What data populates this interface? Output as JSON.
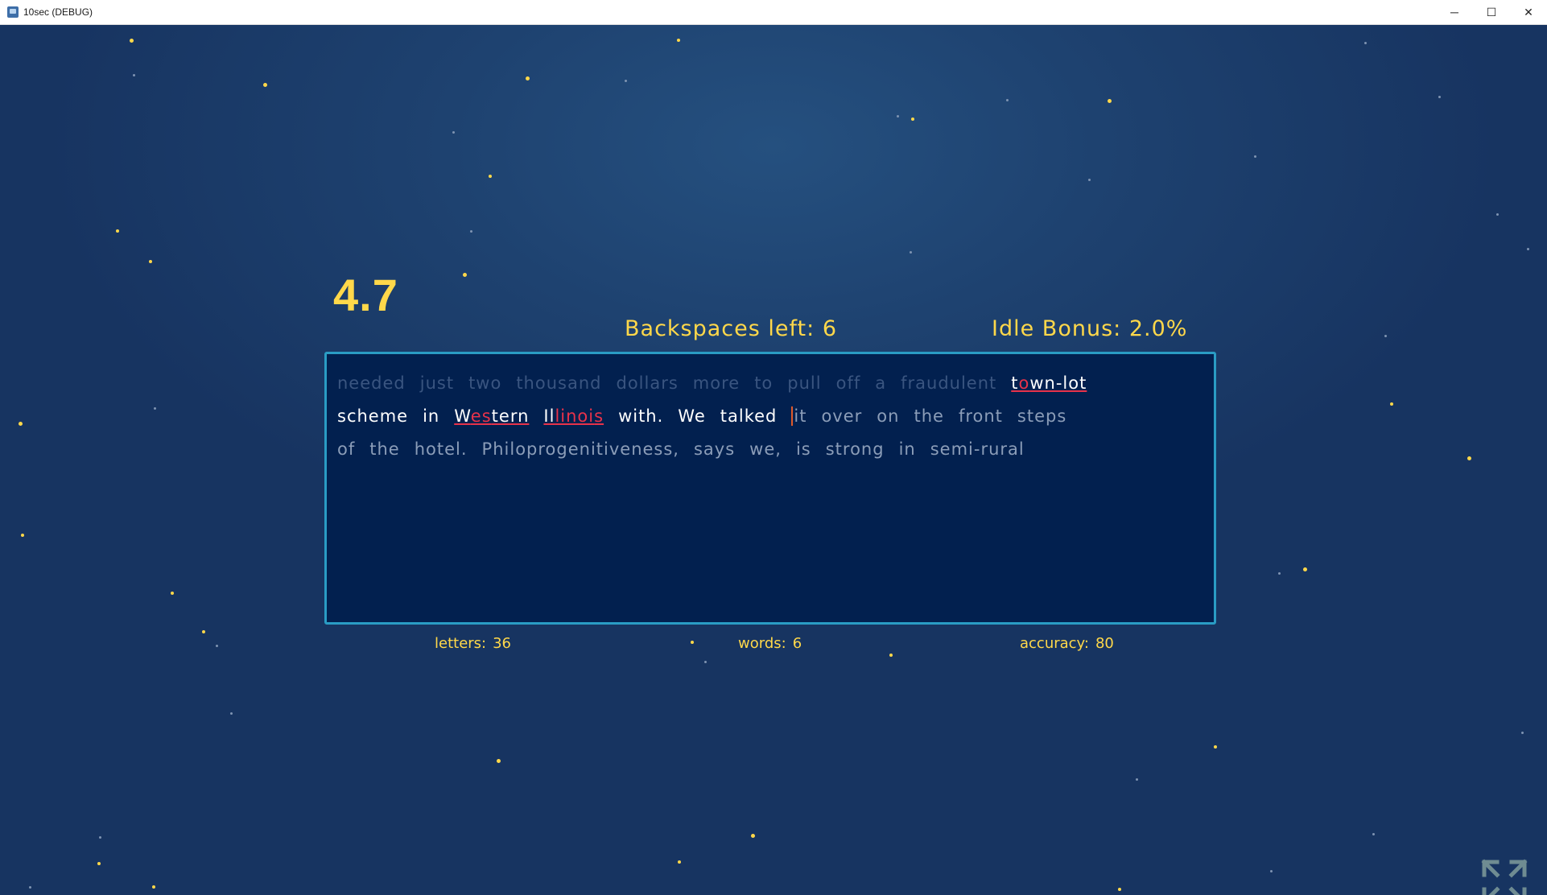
{
  "window": {
    "title": "10sec (DEBUG)",
    "controls": {
      "minimize": "─",
      "maximize": "☐",
      "close": "✕"
    }
  },
  "hud": {
    "timer": "4.7",
    "backspaces_label": "Backspaces left:",
    "backspaces_value": "6",
    "idle_label": "Idle Bonus:",
    "idle_value": "2.0%"
  },
  "text": {
    "line1": [
      {
        "t": "needed",
        "s": "faded"
      },
      {
        "t": "just",
        "s": "faded"
      },
      {
        "t": "two",
        "s": "faded"
      },
      {
        "t": "thousand",
        "s": "faded"
      },
      {
        "t": "dollars",
        "s": "faded"
      },
      {
        "t": "more",
        "s": "faded"
      },
      {
        "t": "to",
        "s": "faded"
      },
      {
        "t": "pull",
        "s": "faded"
      },
      {
        "t": "off",
        "s": "faded"
      },
      {
        "t": "a",
        "s": "faded"
      },
      {
        "t": "fraudulent",
        "s": "faded"
      },
      {
        "parts": [
          [
            "t",
            "typed"
          ],
          [
            "o",
            "err"
          ],
          [
            "wn-lot",
            "typed"
          ]
        ],
        "underline": true
      }
    ],
    "line2": [
      {
        "t": "scheme",
        "s": "typed"
      },
      {
        "t": "in",
        "s": "typed"
      },
      {
        "parts": [
          [
            "W",
            "typed"
          ],
          [
            "es",
            "err"
          ],
          [
            "tern",
            "typed"
          ]
        ],
        "underline": true
      },
      {
        "parts": [
          [
            "Il",
            "typed"
          ],
          [
            "linoi",
            "err"
          ],
          [
            "s",
            "err"
          ]
        ],
        "underline": true
      },
      {
        "t": "with.",
        "s": "typed"
      },
      {
        "t": "We",
        "s": "typed"
      },
      {
        "t": "talked",
        "s": "typed"
      },
      {
        "t": "it",
        "s": "pending",
        "caret": true
      },
      {
        "t": "over",
        "s": "pending"
      },
      {
        "t": "on",
        "s": "pending"
      },
      {
        "t": "the",
        "s": "pending"
      },
      {
        "t": "front",
        "s": "pending"
      },
      {
        "t": "steps",
        "s": "pending"
      }
    ],
    "line3": [
      {
        "t": "of",
        "s": "pending"
      },
      {
        "t": "the",
        "s": "pending"
      },
      {
        "t": "hotel.",
        "s": "pending"
      },
      {
        "t": "Philoprogenitiveness,",
        "s": "pending"
      },
      {
        "t": "says",
        "s": "pending"
      },
      {
        "t": "we,",
        "s": "pending"
      },
      {
        "t": "is",
        "s": "pending"
      },
      {
        "t": "strong",
        "s": "pending"
      },
      {
        "t": "in",
        "s": "pending"
      },
      {
        "t": "semi-rural",
        "s": "pending"
      }
    ]
  },
  "stats": {
    "letters_label": "letters:",
    "letters_value": "36",
    "words_label": "words:",
    "words_value": "6",
    "accuracy_label": "accuracy:",
    "accuracy_value": "80"
  },
  "colors": {
    "accent": "#ffd84a",
    "error": "#e8324a",
    "border": "#2a9cc4",
    "textbox_bg": "#02204f"
  }
}
